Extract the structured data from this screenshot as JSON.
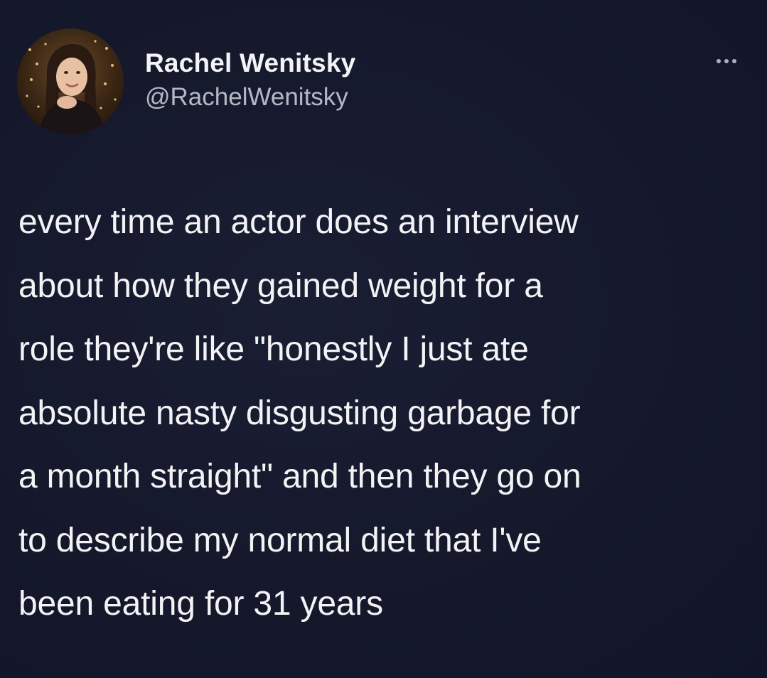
{
  "author": {
    "display_name": "Rachel Wenitsky",
    "handle": "@RachelWenitsky",
    "avatar_icon": "profile-photo"
  },
  "more_icon": "ellipsis-icon",
  "tweet": {
    "lines": [
      "every time an actor does an interview",
      "about how they gained weight for a",
      "role they're like \"honestly I just ate",
      "absolute nasty disgusting garbage for",
      "a month straight\" and then they go on",
      "to describe my normal diet that I've",
      "been eating for 31 years"
    ]
  },
  "colors": {
    "background": "#15182b",
    "text": "#f3f3f5",
    "handle": "#b5b8c4"
  }
}
